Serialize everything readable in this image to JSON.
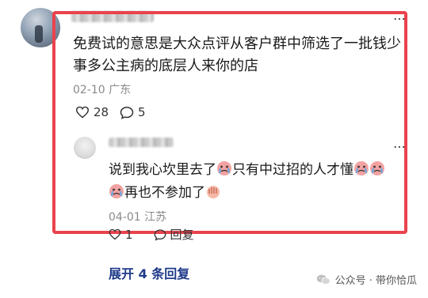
{
  "main_comment": {
    "text": "免费试的意思是大众点评从客户群中筛选了一批钱少事多公主病的底层人来你的店",
    "date": "02-10",
    "location": "广东",
    "likes": "28",
    "replies": "5",
    "more_icon": "more-dots-icon"
  },
  "reply": {
    "text_part1": "说到我心坎里去了",
    "text_part2": "只有中过招的人才懂",
    "text_part3": "再也不参加了",
    "date": "04-01",
    "location": "江苏",
    "likes": "1",
    "reply_label": "回复"
  },
  "expand_label": "展开 4 条回复",
  "watermark": {
    "text": "公众号 · 带你恰瓜",
    "icon": "wechat-icon"
  },
  "colors": {
    "highlight": "#e9434d",
    "link": "#1e3a8a",
    "meta": "#8a8a8a"
  }
}
